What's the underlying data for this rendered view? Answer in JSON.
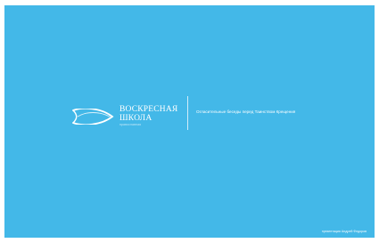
{
  "slide": {
    "background_color": "#43b8e8",
    "logo": {
      "icon": "fish-icon",
      "line1": "ВОСКРЕСНАЯ",
      "line2": "ШКОЛА",
      "tagline": "православная"
    },
    "subtitle": "Огласительные беседы перед Таинством Крещения",
    "credit": "презентация Андрей Федоров"
  }
}
